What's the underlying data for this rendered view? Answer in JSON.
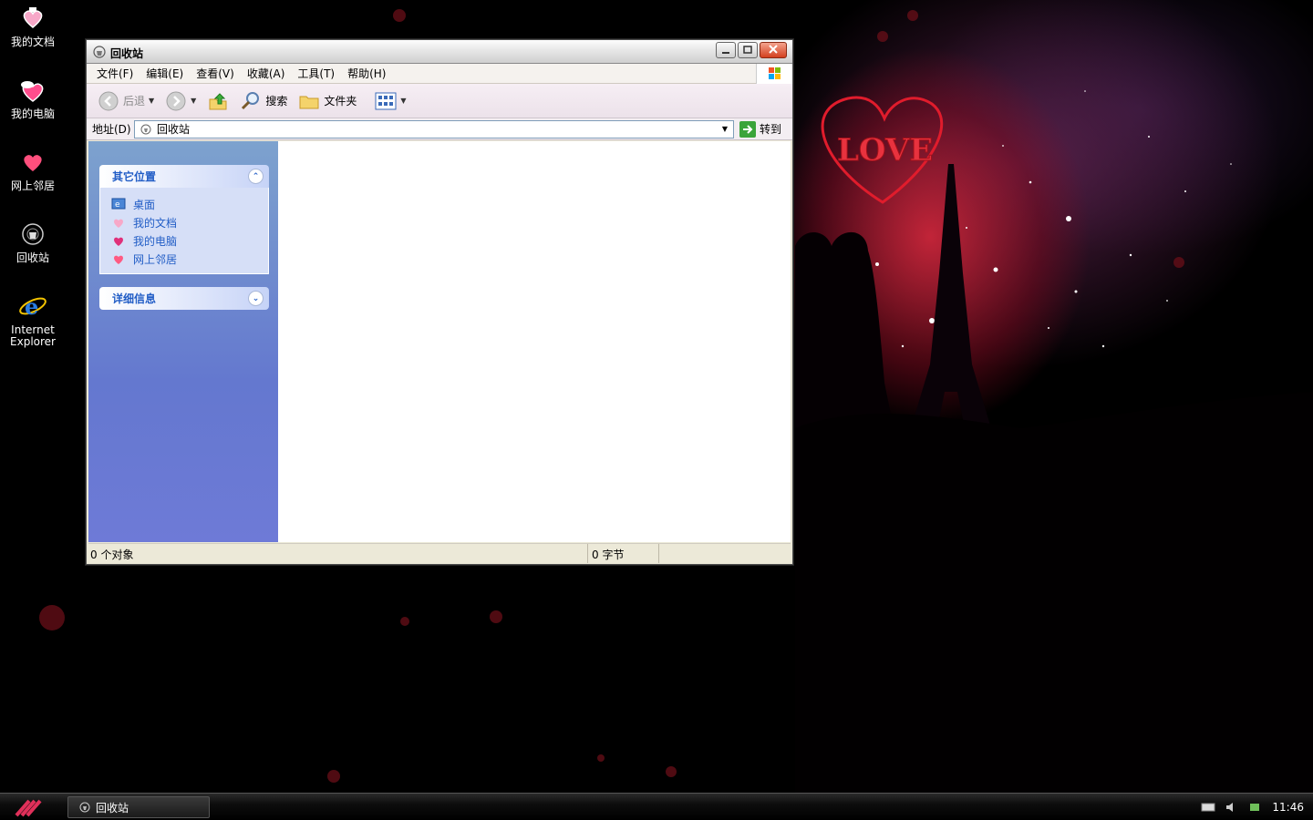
{
  "desktop": {
    "icons": [
      {
        "label": "我的文档",
        "icon": "my-documents-icon"
      },
      {
        "label": "我的电脑",
        "icon": "my-computer-icon"
      },
      {
        "label": "网上邻居",
        "icon": "network-places-icon"
      },
      {
        "label": "回收站",
        "icon": "recycle-bin-icon"
      },
      {
        "label_line1": "Internet",
        "label_line2": "Explorer",
        "icon": "internet-explorer-icon"
      }
    ],
    "wallpaper_text": "LOVE"
  },
  "window": {
    "title": "回收站",
    "menu": [
      "文件(F)",
      "编辑(E)",
      "查看(V)",
      "收藏(A)",
      "工具(T)",
      "帮助(H)"
    ],
    "toolbar": {
      "back_label": "后退",
      "search_label": "搜索",
      "folders_label": "文件夹"
    },
    "address": {
      "label": "地址(D)",
      "value": "回收站",
      "go_label": "转到"
    },
    "taskpane": {
      "other_places": {
        "title": "其它位置",
        "links": [
          "桌面",
          "我的文档",
          "我的电脑",
          "网上邻居"
        ]
      },
      "details": {
        "title": "详细信息"
      }
    },
    "status": {
      "objects": "0 个对象",
      "size": "0 字节"
    }
  },
  "taskbar": {
    "task_label": "回收站",
    "clock": "11:46"
  },
  "colors": {
    "link_blue": "#215dc6",
    "taskpane_top": "#7da2ce",
    "taskpane_bottom": "#6e7ad7"
  }
}
